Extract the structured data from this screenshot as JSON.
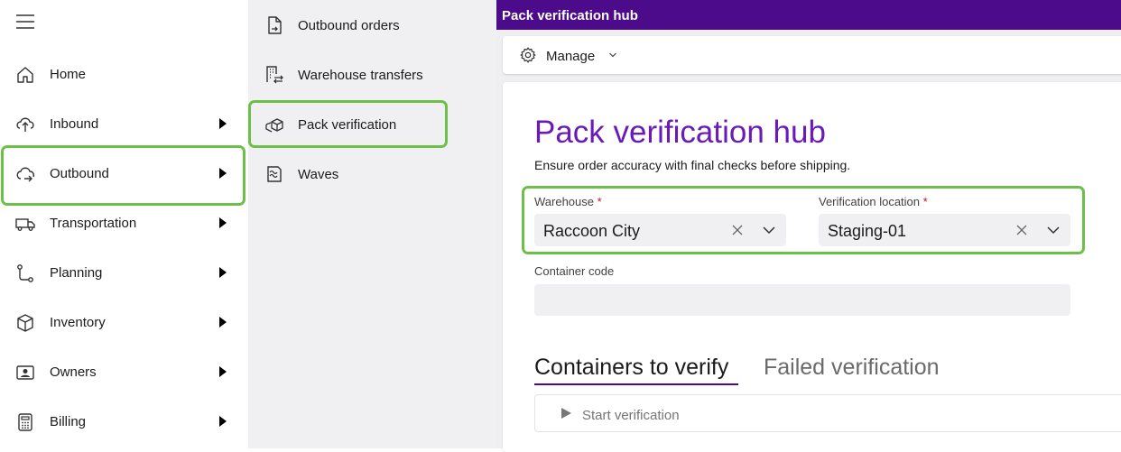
{
  "nav": {
    "items": [
      {
        "label": "Home",
        "icon": "home-icon"
      },
      {
        "label": "Inbound",
        "icon": "inbound-icon"
      },
      {
        "label": "Outbound",
        "icon": "outbound-icon"
      },
      {
        "label": "Transportation",
        "icon": "truck-icon"
      },
      {
        "label": "Planning",
        "icon": "planning-icon"
      },
      {
        "label": "Inventory",
        "icon": "box-icon"
      },
      {
        "label": "Owners",
        "icon": "contact-card-icon"
      },
      {
        "label": "Billing",
        "icon": "calculator-icon"
      }
    ]
  },
  "submenu": {
    "items": [
      {
        "label": "Outbound orders",
        "icon": "document-icon"
      },
      {
        "label": "Warehouse transfers",
        "icon": "building-transfer-icon"
      },
      {
        "label": "Pack verification",
        "icon": "boxes-icon"
      },
      {
        "label": "Waves",
        "icon": "waves-icon"
      }
    ]
  },
  "titlebar": {
    "title": "Pack verification hub"
  },
  "toolbar": {
    "manage_label": "Manage"
  },
  "page": {
    "title": "Pack verification hub",
    "subtitle": "Ensure order accuracy with final checks before shipping."
  },
  "form": {
    "warehouse": {
      "label": "Warehouse",
      "required_mark": "*",
      "value": "Raccoon City"
    },
    "verification_location": {
      "label": "Verification location",
      "required_mark": "*",
      "value": "Staging-01"
    },
    "container_code": {
      "label": "Container code",
      "value": ""
    }
  },
  "tabs": [
    {
      "label": "Containers to verify",
      "active": true
    },
    {
      "label": "Failed verification",
      "active": false
    }
  ],
  "actions": {
    "start_verification_label": "Start verification"
  },
  "colors": {
    "titlebar": "#4b0b8a",
    "page_title": "#6a1bb5",
    "highlight": "#6cc04a",
    "required": "#c50f1f"
  }
}
